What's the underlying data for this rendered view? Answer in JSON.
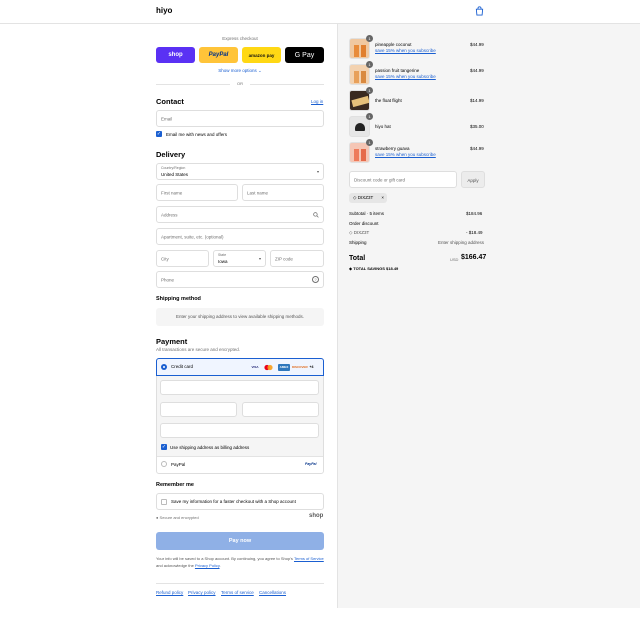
{
  "header": {
    "logo": "hiyo",
    "cart_icon": "shopping-bag-icon"
  },
  "express": {
    "title": "Express checkout",
    "buttons": [
      "shop",
      "PayPal",
      "amazon pay",
      "G Pay"
    ],
    "more": "Show more options",
    "or": "OR",
    "colors": {
      "shop": "#5a31f4",
      "paypal": "#ffc439",
      "amazon": "#ffd814",
      "gpay": "#000000"
    }
  },
  "contact": {
    "title": "Contact",
    "login": "Log in",
    "email_placeholder": "Email",
    "newsletter": "Email me with news and offers"
  },
  "delivery": {
    "title": "Delivery",
    "country_label": "Country/Region",
    "country_value": "United States",
    "first_name": "First name",
    "last_name": "Last name",
    "address": "Address",
    "apartment": "Apartment, suite, etc. (optional)",
    "city": "City",
    "state_label": "State",
    "state_value": "Iowa",
    "zip": "ZIP code",
    "phone": "Phone"
  },
  "shipping_method": {
    "title": "Shipping method",
    "notice": "Enter your shipping address to view available shipping methods."
  },
  "payment": {
    "title": "Payment",
    "subtitle": "All transactions are secure and encrypted.",
    "credit_card": "Credit card",
    "brands": [
      "VISA",
      "MC",
      "AMEX",
      "DISCOVER",
      "+4"
    ],
    "billing_same": "Use shipping address as billing address",
    "paypal": "PayPal",
    "paypal_badge": "PayPal"
  },
  "remember": {
    "title": "Remember me",
    "save_info": "Save my information for a faster checkout with a Shop account",
    "secure": "Secure and encrypted",
    "shop_logo": "shop"
  },
  "pay_button": "Pay now",
  "legal": {
    "text1": "Your info will be saved to a Shop account. By continuing, you agree to Shop's",
    "terms": "Terms of Service",
    "text2": "and acknowledge the",
    "privacy": "Privacy Policy",
    "period": "."
  },
  "footer_links": [
    "Refund policy",
    "Privacy policy",
    "Terms of service",
    "Cancellations"
  ],
  "cart": {
    "items": [
      {
        "name": "pineapple coconut",
        "sub": "save 15% when you subscribe",
        "price": "$44.99",
        "qty": "1"
      },
      {
        "name": "passion fruit tangerine",
        "sub": "save 15% when you subscribe",
        "price": "$44.99",
        "qty": "1"
      },
      {
        "name": "the float flight",
        "sub": "",
        "price": "$14.99",
        "qty": "1"
      },
      {
        "name": "hiyo hat",
        "sub": "",
        "price": "$35.00",
        "qty": "1"
      },
      {
        "name": "strawberry guava",
        "sub": "save 15% when you subscribe",
        "price": "$44.99",
        "qty": "1"
      }
    ],
    "discount_placeholder": "Discount code or gift card",
    "apply": "Apply",
    "code_chip": "DIXZ3T",
    "subtotal_label": "Subtotal · 5 items",
    "subtotal_value": "$184.96",
    "order_discount_label": "Order discount",
    "discount_code": "DIXZ3T",
    "discount_value": "- $18.49",
    "shipping_label": "Shipping",
    "shipping_value": "Enter shipping address",
    "total_label": "Total",
    "currency": "USD",
    "total_value": "$166.47",
    "savings_label": "TOTAL SAVINGS",
    "savings_value": "$18.49"
  }
}
